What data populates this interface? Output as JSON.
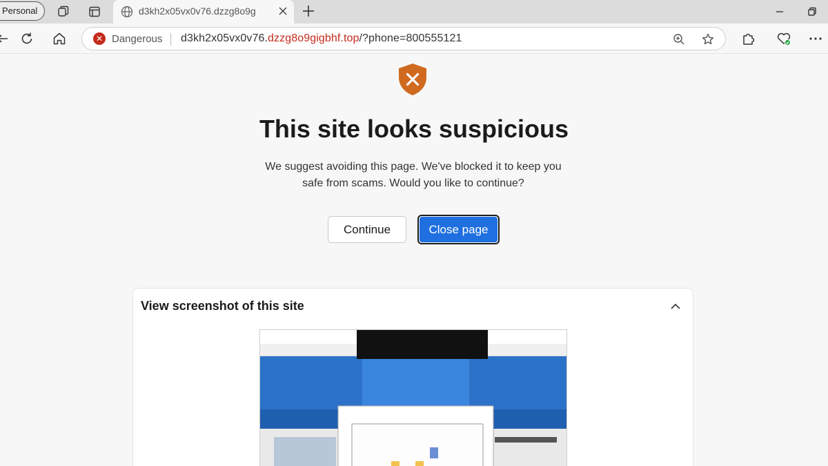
{
  "browser": {
    "profile_label": "Personal",
    "tab": {
      "title": "d3kh2x05vx0v76.dzzg8o9g"
    }
  },
  "address_bar": {
    "security_label": "Dangerous",
    "url_host_prefix": "d3kh2x05vx0v76.",
    "url_domain": "dzzg8o9gigbhf.top",
    "url_path": "/?phone=800555121"
  },
  "warning": {
    "headline": "This site looks suspicious",
    "message": "We suggest avoiding this page. We've blocked it to keep you safe from scams. Would you like to continue?",
    "continue_label": "Continue",
    "close_label": "Close page"
  },
  "screenshot_panel": {
    "title": "View screenshot of this site"
  },
  "colors": {
    "danger": "#c42b1c",
    "accent": "#1f6fe0",
    "shield": "#d06a1f"
  }
}
